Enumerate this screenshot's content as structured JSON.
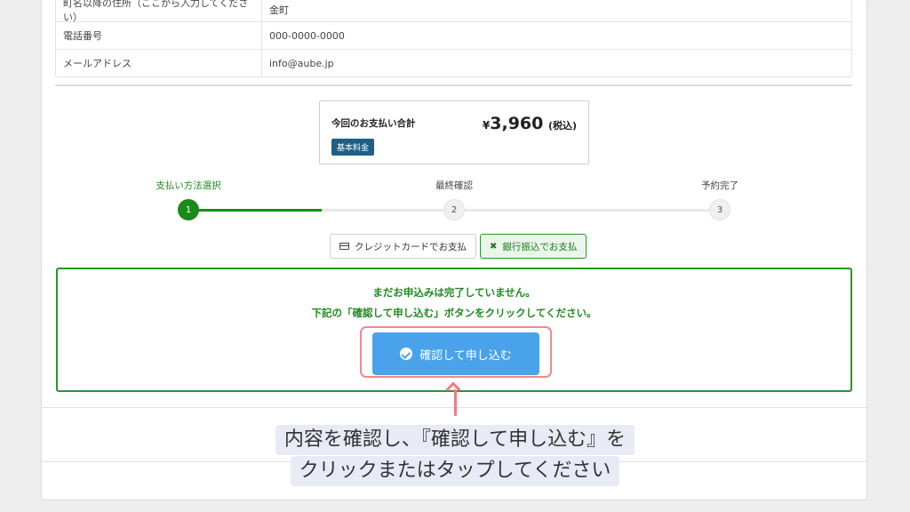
{
  "info_table": {
    "rows": [
      {
        "label": "町名以降の住所（ここから入力してください）",
        "value": "金町"
      },
      {
        "label": "電話番号",
        "value": "000-0000-0000"
      },
      {
        "label": "メールアドレス",
        "value": "info@aube.jp"
      }
    ]
  },
  "summary": {
    "label": "今回のお支払い合計",
    "currency": "¥",
    "amount": "3,960",
    "tax_note": "(税込)",
    "badge": "基本料金"
  },
  "steps": [
    {
      "label": "支払い方法選択",
      "number": "1",
      "active": true
    },
    {
      "label": "最終確認",
      "number": "2",
      "active": false
    },
    {
      "label": "予約完了",
      "number": "3",
      "active": false
    }
  ],
  "payment_tabs": {
    "credit": "クレジットカードでお支払",
    "bank": "銀行振込でお支払"
  },
  "notice": {
    "line1": "まだお申込みは完了していません。",
    "line2": "下記の「確認して申し込む」ボタンをクリックしてください。",
    "confirm_label": "確認して申し込む"
  },
  "callout": {
    "line1": "内容を確認し、『確認して申し込む』を",
    "line2": "クリックまたはタップしてください"
  },
  "colors": {
    "accent_green": "#1e8a1e",
    "button_blue": "#4aa3ea",
    "highlight_pink": "#f0888e",
    "badge_navy": "#1f5f86",
    "callout_bg": "#e8eaf6"
  }
}
